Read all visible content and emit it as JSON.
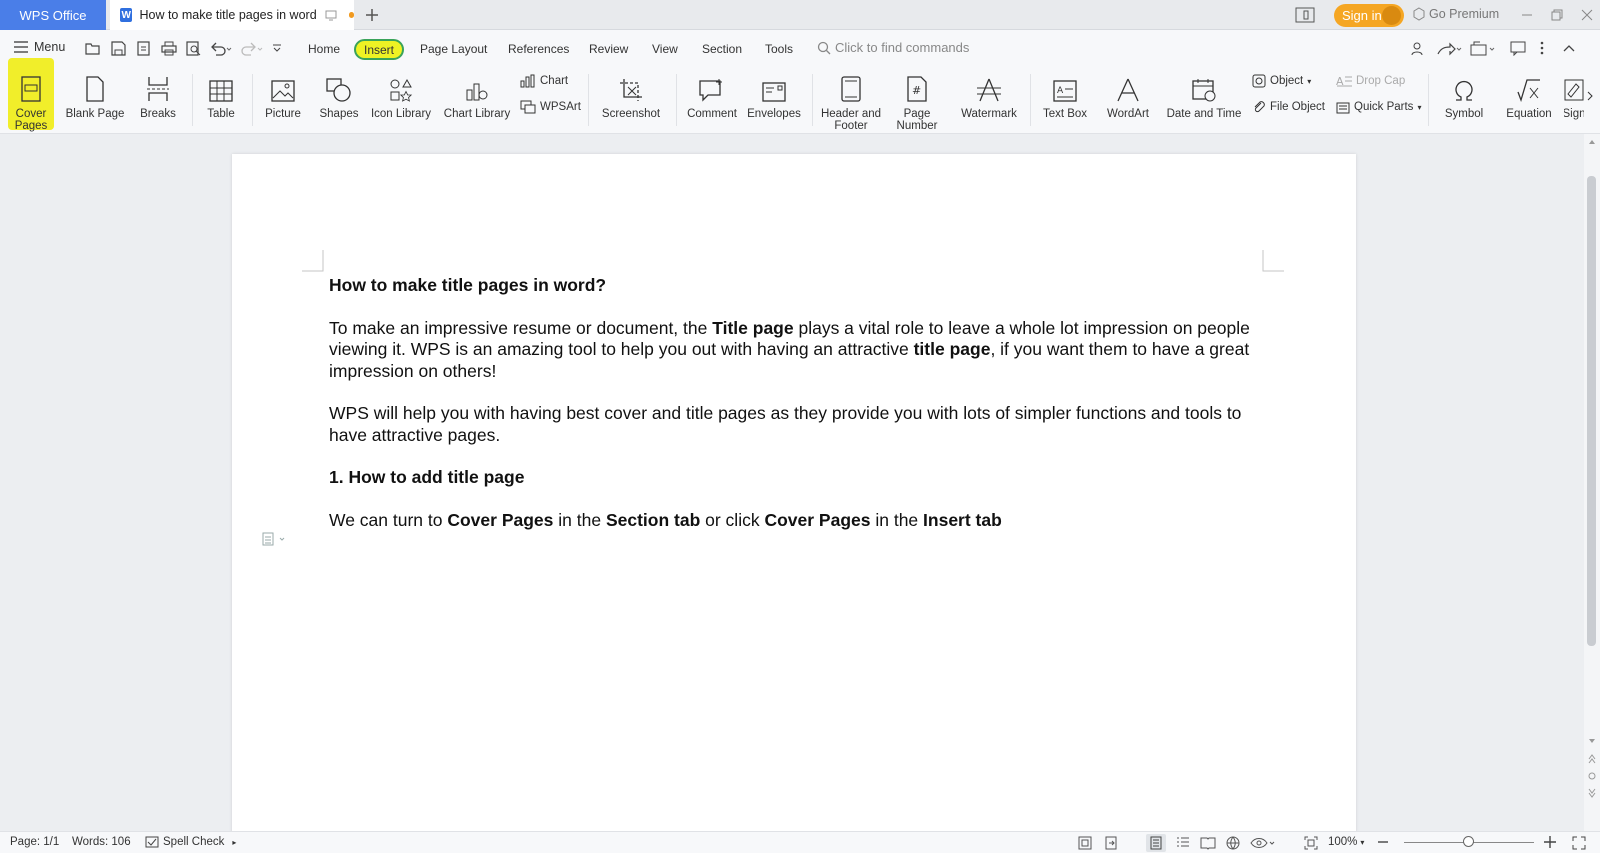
{
  "titlebar": {
    "app_tab": "WPS Office",
    "doc_tab": "How to make title pages in word",
    "sign_in": "Sign in",
    "go_premium": "Go Premium"
  },
  "menurow": {
    "menu_label": "Menu",
    "tabs": [
      "Home",
      "Insert",
      "Page Layout",
      "References",
      "Review",
      "View",
      "Section",
      "Tools"
    ],
    "active_tab": "Insert",
    "find_placeholder": "Click to find commands"
  },
  "ribbon": {
    "cover_pages": "Cover Pages",
    "cover_line1": "Cover",
    "cover_line2": "Pages",
    "blank_page": "Blank Page",
    "breaks": "Breaks",
    "table": "Table",
    "picture": "Picture",
    "shapes": "Shapes",
    "icon_library": "Icon Library",
    "chart_library": "Chart Library",
    "chart": "Chart",
    "wpsart": "WPSArt",
    "screenshot": "Screenshot",
    "comment": "Comment",
    "envelopes": "Envelopes",
    "header_line1": "Header and",
    "header_line2": "Footer",
    "pagenum_line1": "Page",
    "pagenum_line2": "Number",
    "watermark": "Watermark",
    "text_box": "Text Box",
    "wordart": "WordArt",
    "date_time": "Date and Time",
    "object": "Object",
    "file_object": "File Object",
    "drop_cap": "Drop Cap",
    "quick_parts": "Quick Parts",
    "symbol": "Symbol",
    "equation": "Equation",
    "signature_partial": "Sign"
  },
  "document": {
    "heading": "How to make title pages in word?",
    "p1_a": "To make an impressive resume or document, the ",
    "p1_b": "Title page",
    "p1_c": " plays a vital role to leave a whole lot impression on people viewing it. WPS is an amazing tool to help you out with having an attractive ",
    "p1_d": "title page",
    "p1_e": ", if you want them to have a great impression on others!",
    "p2": "WPS will help you with having best cover and title pages as they provide you with lots of simpler functions and tools to have attractive pages.",
    "subheading": "1. How to add title page",
    "p3_a": "We can turn to ",
    "p3_b": "Cover Pages",
    "p3_c": " in the ",
    "p3_d": "Section tab",
    "p3_e": " or click ",
    "p3_f": "Cover Pages",
    "p3_g": " in the ",
    "p3_h": "Insert tab"
  },
  "statusbar": {
    "page": "Page: 1/1",
    "words": "Words: 106",
    "spell_check": "Spell Check",
    "zoom": "100%"
  },
  "colors": {
    "accent": "#4a7ee8",
    "signin": "#f5a623",
    "highlight": "#f1ee2a"
  }
}
